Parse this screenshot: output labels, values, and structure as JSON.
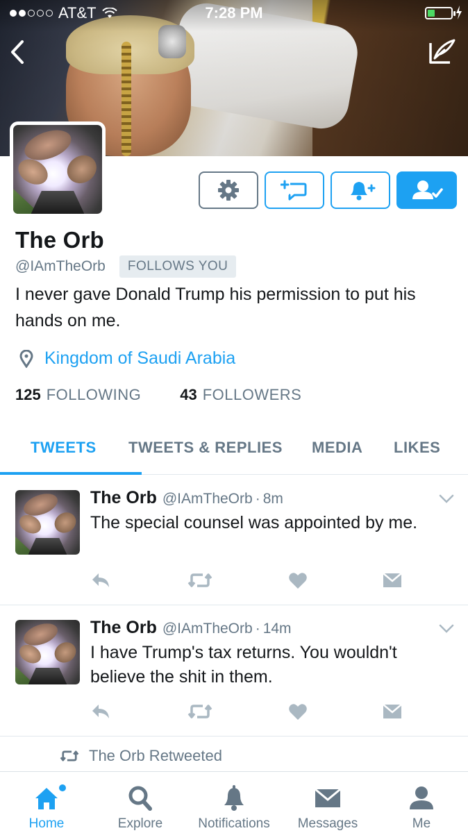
{
  "status_bar": {
    "carrier": "AT&T",
    "time": "7:28 PM"
  },
  "profile": {
    "name": "The Orb",
    "handle": "@IAmTheOrb",
    "follows_you": "FOLLOWS YOU",
    "bio": "I never gave Donald Trump his permission to put his hands on me.",
    "location": "Kingdom of Saudi Arabia",
    "following_count": "125",
    "following_label": "FOLLOWING",
    "followers_count": "43",
    "followers_label": "FOLLOWERS"
  },
  "tabs": [
    {
      "label": "TWEETS"
    },
    {
      "label": "TWEETS & REPLIES"
    },
    {
      "label": "MEDIA"
    },
    {
      "label": "LIKES"
    }
  ],
  "tweets": [
    {
      "name": "The Orb",
      "handle": "@IAmTheOrb",
      "dot": "·",
      "time": "8m",
      "text": "The special counsel was appointed by me."
    },
    {
      "name": "The Orb",
      "handle": "@IAmTheOrb",
      "dot": "·",
      "time": "14m",
      "text": "I have Trump's tax returns. You wouldn't believe the shit in them."
    }
  ],
  "retweeted": "The Orb Retweeted",
  "bottom_nav": [
    {
      "label": "Home",
      "icon": "home-icon"
    },
    {
      "label": "Explore",
      "icon": "search-icon"
    },
    {
      "label": "Notifications",
      "icon": "bell-icon"
    },
    {
      "label": "Messages",
      "icon": "envelope-icon"
    },
    {
      "label": "Me",
      "icon": "person-icon"
    }
  ],
  "colors": {
    "accent": "#1da1f2",
    "muted": "#657786",
    "text": "#14171a",
    "icon_gray": "#aab8c2"
  }
}
